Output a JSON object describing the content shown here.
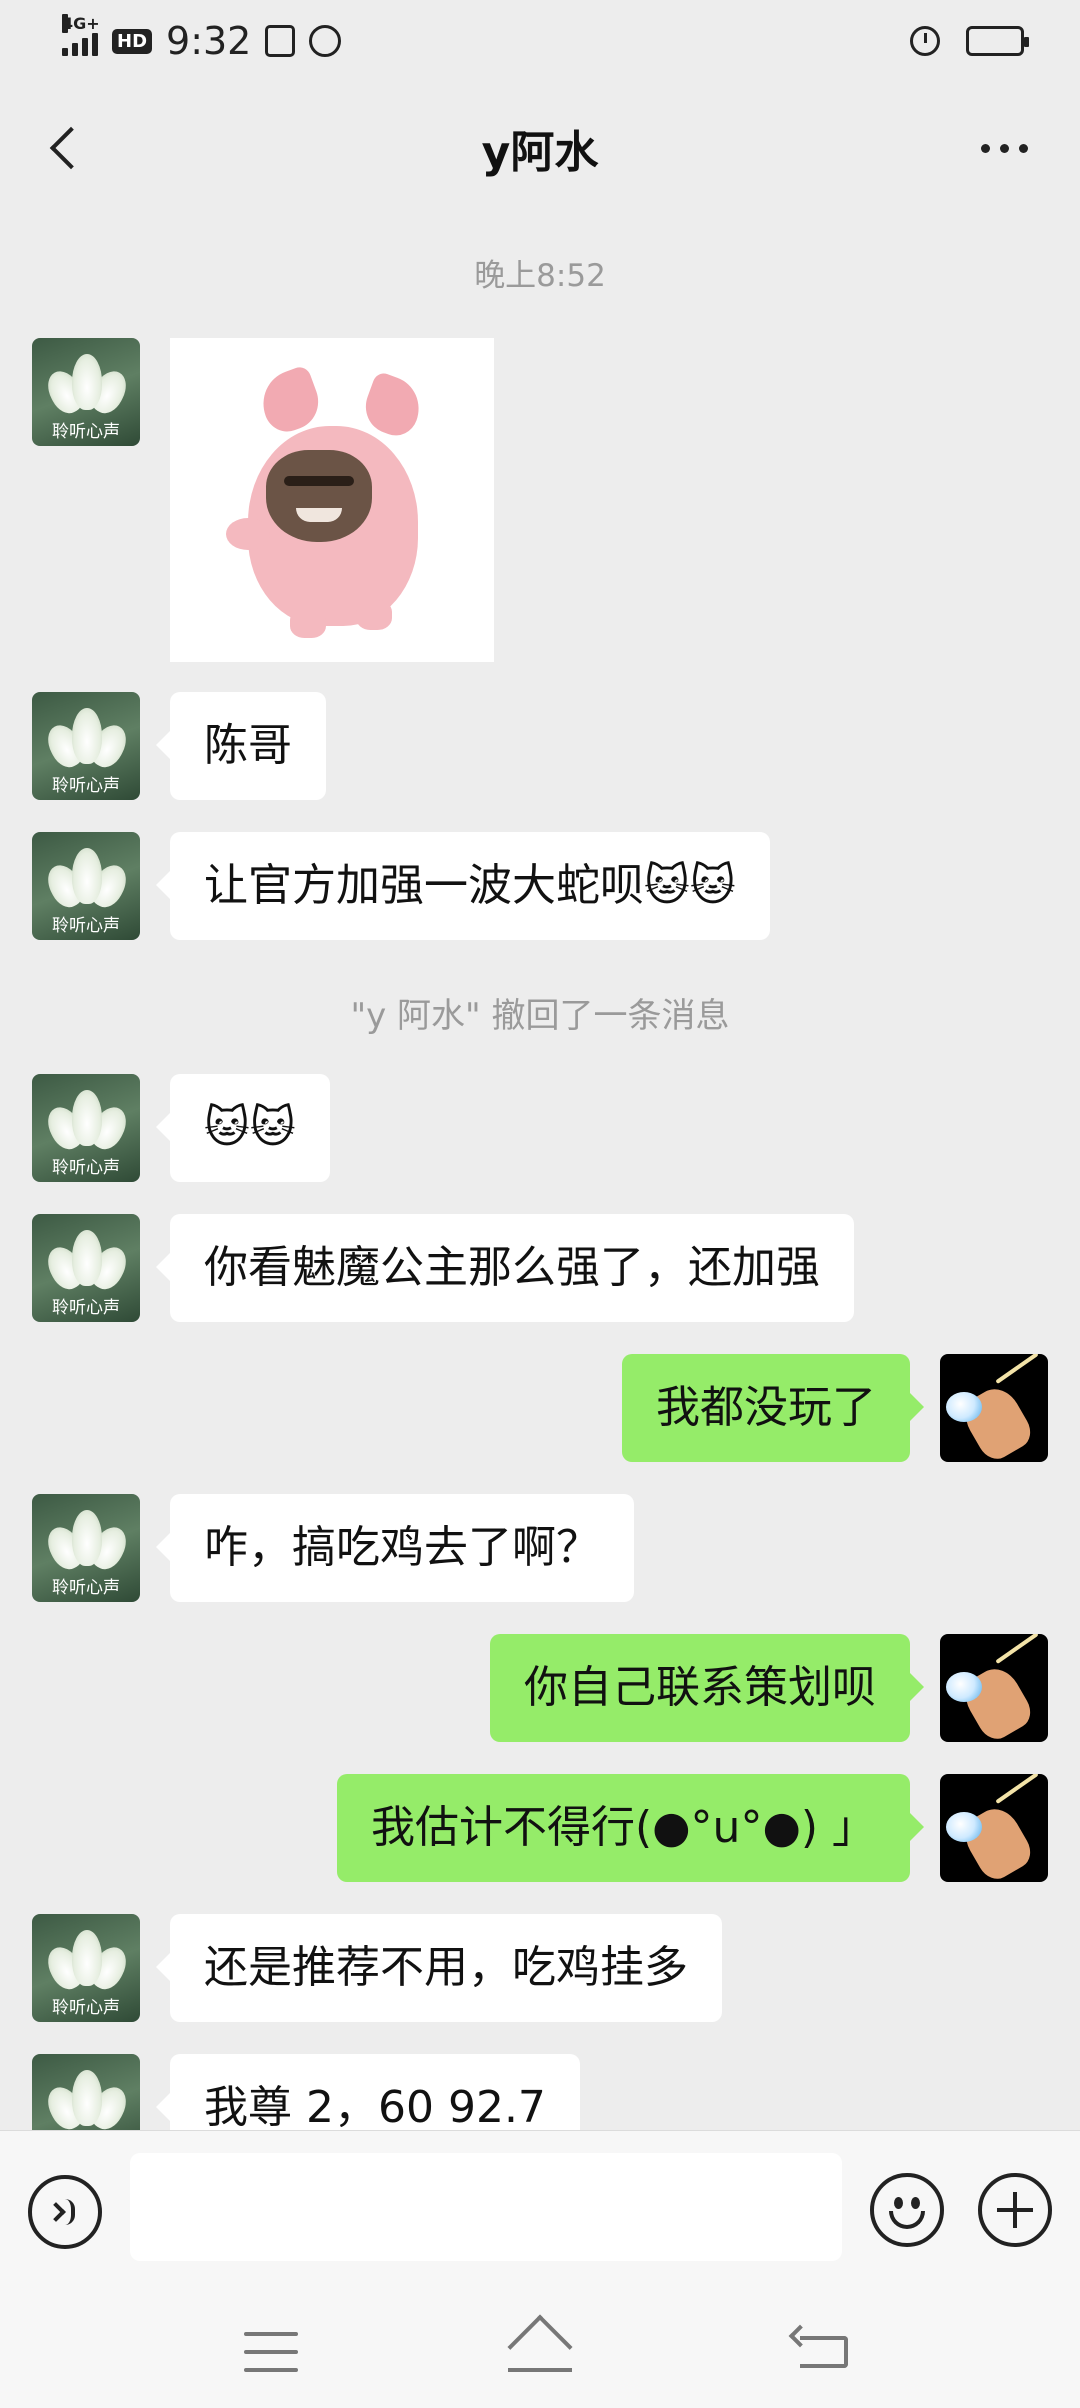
{
  "status_bar": {
    "network": "4G+",
    "hd": "HD",
    "time": "9:32"
  },
  "header": {
    "title": "y阿水"
  },
  "chat": {
    "timestamp": "晚上8:52",
    "messages": [
      {
        "from": "them",
        "type": "sticker"
      },
      {
        "from": "them",
        "text": "陈哥"
      },
      {
        "from": "them",
        "text": "让官方加强一波大蛇呗🐱🐱"
      },
      {
        "from": "system",
        "text": "\"y 阿水\" 撤回了一条消息"
      },
      {
        "from": "them",
        "text": "🐱🐱"
      },
      {
        "from": "them",
        "text": "你看魅魔公主那么强了，还加强"
      },
      {
        "from": "me",
        "text": "我都没玩了"
      },
      {
        "from": "them",
        "text": "咋，搞吃鸡去了啊？"
      },
      {
        "from": "me",
        "text": "你自己联系策划呗"
      },
      {
        "from": "me",
        "text": "我估计不得行(●°u°●)​ 」"
      },
      {
        "from": "them",
        "text": "还是推荐不用，吃鸡挂多"
      },
      {
        "from": "them",
        "text": "我尊 2，60  92.7"
      }
    ],
    "avatar_caption": "聆听心声"
  },
  "input_bar": {
    "placeholder": ""
  }
}
